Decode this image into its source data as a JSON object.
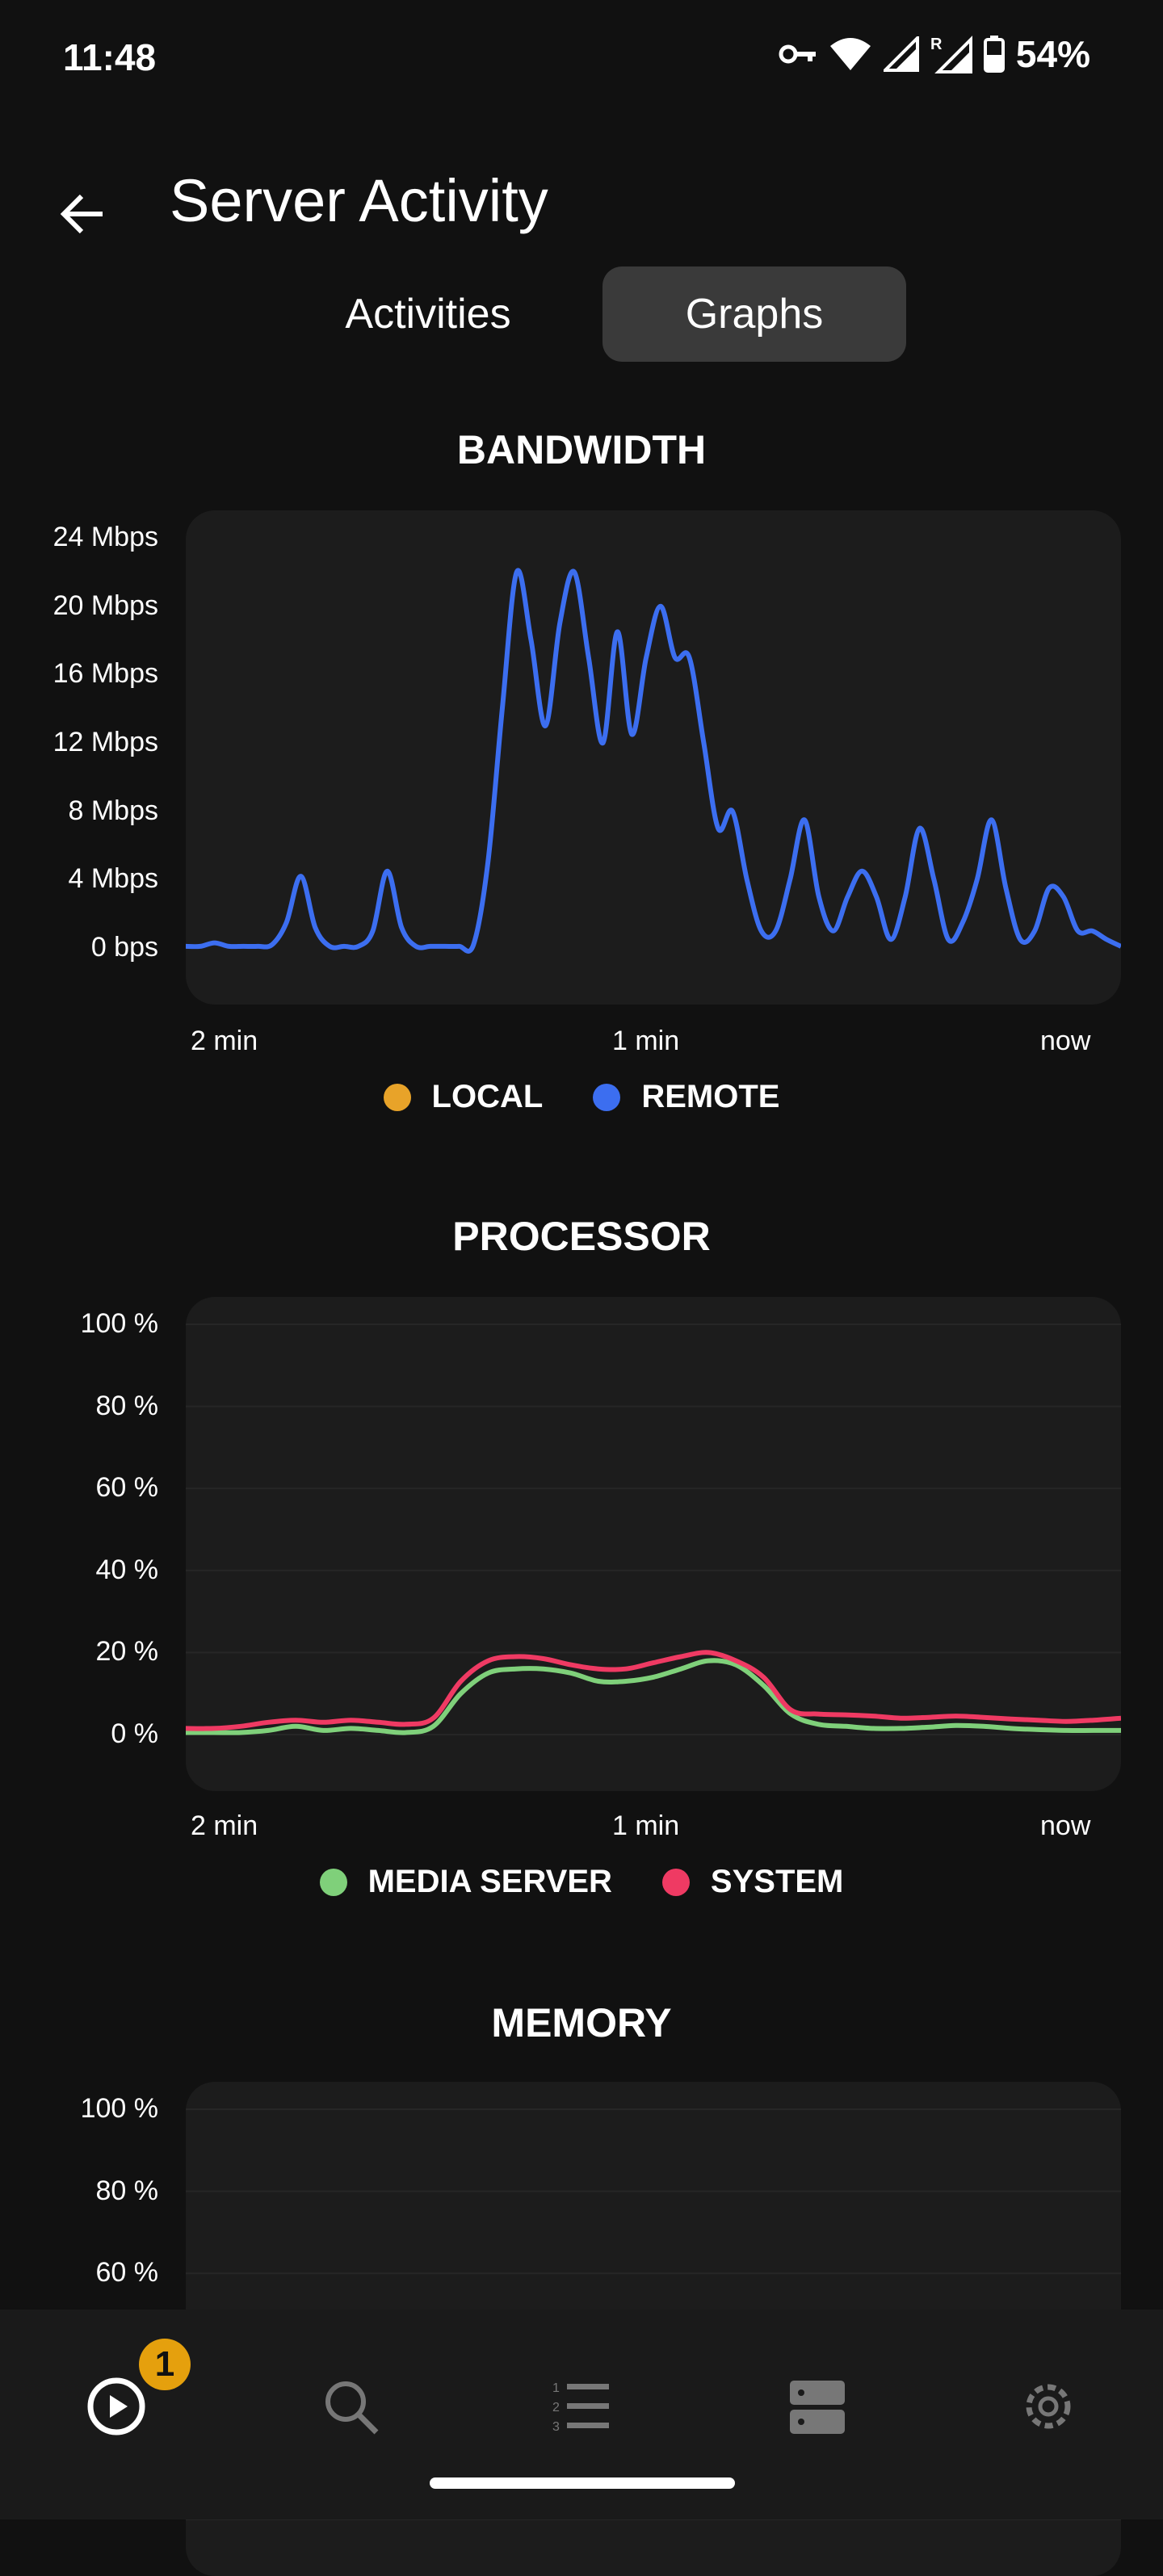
{
  "status": {
    "time": "11:48",
    "battery": "54%"
  },
  "header": {
    "title": "Server Activity"
  },
  "tabs": {
    "activities": "Activities",
    "graphs": "Graphs",
    "selected": "Graphs"
  },
  "colors": {
    "local": "#e8a329",
    "remote": "#3c6ef0",
    "media_server": "#7fd07a",
    "system": "#ef3a63",
    "accent": "#e5a00d"
  },
  "bandwidth": {
    "title": "BANDWIDTH",
    "yticks": [
      "24 Mbps",
      "20 Mbps",
      "16 Mbps",
      "12 Mbps",
      "8 Mbps",
      "4 Mbps",
      "0 bps"
    ],
    "xticks": [
      "2 min",
      "1 min",
      "now"
    ],
    "legend": [
      "LOCAL",
      "REMOTE"
    ]
  },
  "processor": {
    "title": "PROCESSOR",
    "yticks": [
      "100 %",
      "80 %",
      "60 %",
      "40 %",
      "20 %",
      "0 %"
    ],
    "xticks": [
      "2 min",
      "1 min",
      "now"
    ],
    "legend": [
      "MEDIA SERVER",
      "SYSTEM"
    ]
  },
  "memory": {
    "title": "MEMORY",
    "yticks": [
      "100 %",
      "80 %",
      "60 %"
    ]
  },
  "bottom_nav": {
    "items": [
      "play-icon",
      "search-icon",
      "queue-icon",
      "server-icon",
      "settings-icon"
    ],
    "badge": "1"
  },
  "chart_data": [
    {
      "type": "line",
      "title": "BANDWIDTH",
      "xlabel": "",
      "ylabel": "",
      "ylim": [
        0,
        24
      ],
      "x_range_label": [
        "2 min",
        "1 min",
        "now"
      ],
      "series": [
        {
          "name": "LOCAL",
          "values": []
        },
        {
          "name": "REMOTE",
          "values": [
            0.1,
            0.1,
            0.3,
            0.1,
            0.1,
            0.1,
            0.2,
            1.5,
            4.2,
            1.2,
            0.1,
            0.1,
            0.1,
            1.0,
            4.5,
            1.2,
            0.1,
            0.1,
            0.1,
            0.1,
            0.2,
            5.0,
            14.0,
            22.0,
            18.0,
            13.0,
            19.0,
            22.0,
            17.0,
            12.0,
            18.5,
            12.5,
            17.0,
            20.0,
            17.0,
            17.0,
            12.0,
            7.0,
            8.0,
            4.0,
            1.0,
            1.0,
            4.0,
            7.5,
            3.0,
            1.0,
            3.0,
            4.5,
            3.0,
            0.5,
            3.0,
            7.0,
            4.0,
            0.5,
            1.5,
            4.0,
            7.5,
            3.5,
            0.5,
            1.0,
            3.5,
            3.0,
            1.0,
            1.0,
            0.5,
            0.1
          ]
        }
      ]
    },
    {
      "type": "line",
      "title": "PROCESSOR",
      "xlabel": "",
      "ylabel": "",
      "ylim": [
        0,
        100
      ],
      "x_range_label": [
        "2 min",
        "1 min",
        "now"
      ],
      "series": [
        {
          "name": "MEDIA SERVER",
          "values": [
            0.5,
            0.5,
            0.5,
            1.0,
            2.0,
            1.0,
            1.5,
            1.0,
            0.5,
            2.0,
            10.0,
            15.0,
            16.0,
            16.0,
            15.0,
            13.0,
            13.0,
            14.0,
            16.0,
            18.0,
            17.0,
            12.0,
            5.0,
            2.5,
            2.0,
            1.5,
            1.5,
            1.8,
            2.2,
            2.0,
            1.5,
            1.2,
            1.0,
            1.0,
            1.0
          ]
        },
        {
          "name": "SYSTEM",
          "values": [
            1.5,
            1.5,
            2.0,
            3.0,
            3.5,
            3.0,
            3.5,
            3.0,
            2.5,
            4.0,
            13.0,
            18.0,
            19.0,
            18.5,
            17.0,
            16.0,
            16.0,
            17.5,
            19.0,
            20.0,
            18.0,
            14.0,
            6.0,
            5.0,
            4.8,
            4.5,
            4.0,
            4.2,
            4.5,
            4.2,
            3.8,
            3.5,
            3.2,
            3.5,
            4.0
          ]
        }
      ]
    },
    {
      "type": "line",
      "title": "MEMORY",
      "ylim": [
        0,
        100
      ],
      "series": []
    }
  ]
}
